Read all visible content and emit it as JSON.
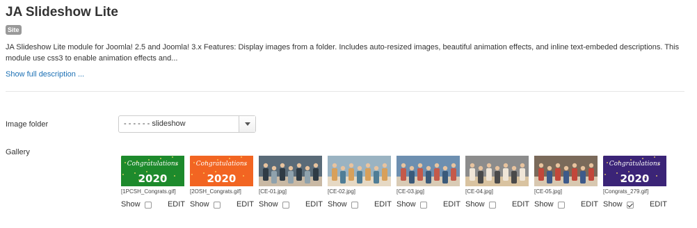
{
  "module": {
    "title": "JA Slideshow Lite",
    "badge": "Site",
    "description": "JA Slideshow Lite module for Joomla! 2.5 and Joomla! 3.x Features: Display images from a folder. Includes auto-resized images, beautiful animation effects, and inline text-embeded descriptions. This module use css3 to enable animation effects and...",
    "show_full_link": "Show full description ..."
  },
  "form": {
    "image_folder_label": "Image folder",
    "image_folder_value": "- - - - - - slideshow",
    "gallery_label": "Gallery",
    "show_label": "Show",
    "edit_label": "EDIT"
  },
  "gallery": [
    {
      "filename": "[1PCSH_Congrats.gif]",
      "show": false,
      "thumb_text": "Congratulations",
      "thumb_year": "2020",
      "thumb_bg": "#1d8a2c",
      "kind": "congrats"
    },
    {
      "filename": "[2OSH_Congrats.gif]",
      "show": false,
      "thumb_text": "Congratulations",
      "thumb_year": "2020",
      "thumb_bg": "#f26522",
      "kind": "congrats"
    },
    {
      "filename": "[CE-01.jpg]",
      "show": false,
      "kind": "photo",
      "palette": [
        "#5a6b78",
        "#2f3b45",
        "#8fa2ad",
        "#c9b9a4"
      ]
    },
    {
      "filename": "[CE-02.jpg]",
      "show": false,
      "kind": "photo",
      "palette": [
        "#9ab3c2",
        "#d8a05a",
        "#4f7d96",
        "#e6d9c4"
      ]
    },
    {
      "filename": "[CE-03.jpg]",
      "show": false,
      "kind": "photo",
      "palette": [
        "#6d8fb0",
        "#c45a4a",
        "#3a5a7a",
        "#d9cbb5"
      ]
    },
    {
      "filename": "[CE-04.jpg]",
      "show": false,
      "kind": "photo",
      "palette": [
        "#8c8c8c",
        "#f0e6d8",
        "#4a4a4a",
        "#d9c3a0"
      ]
    },
    {
      "filename": "[CE-05.jpg]",
      "show": false,
      "kind": "photo",
      "palette": [
        "#7a6a5a",
        "#c2473a",
        "#3d5a8a",
        "#d8c8b0"
      ]
    },
    {
      "filename": "[Congrats_279.gif]",
      "show": true,
      "thumb_text": "Congratulations",
      "thumb_year": "2020",
      "thumb_bg": "#3b2477",
      "kind": "congrats"
    }
  ]
}
